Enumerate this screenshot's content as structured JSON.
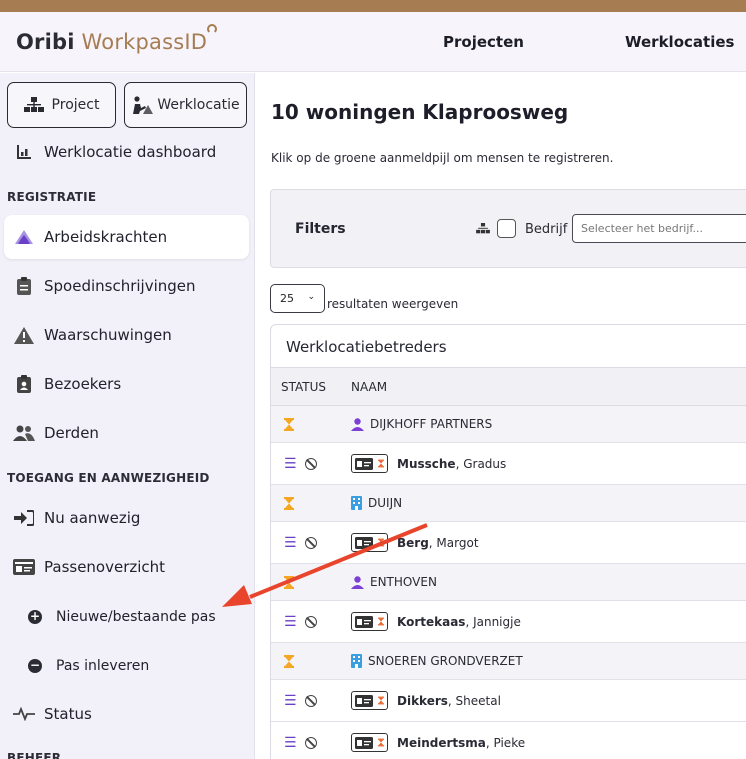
{
  "header": {
    "logo_oribi": "Oribi",
    "logo_workpass": "WorkpassID",
    "nav": [
      "Projecten",
      "Werklocaties"
    ]
  },
  "sidebar": {
    "btn_project": "Project",
    "btn_werklocatie": "Werklocatie",
    "dashboard": "Werklocatie dashboard",
    "heading_registratie": "REGISTRATIE",
    "items_registratie": [
      "Arbeidskrachten",
      "Spoedinschrijvingen",
      "Waarschuwingen",
      "Bezoekers",
      "Derden"
    ],
    "heading_toegang": "TOEGANG EN AANWEZIGHEID",
    "nu_aanwezig": "Nu aanwezig",
    "passenoverzicht": "Passenoverzicht",
    "sub_nieuwe": "Nieuwe/bestaande pas",
    "sub_inleveren": "Pas inleveren",
    "status": "Status",
    "heading_beheer": "BEHEER"
  },
  "main": {
    "title": "10 woningen Klaproosweg",
    "intro": "Klik op de groene aanmeldpijl om mensen te registreren.",
    "filters_label": "Filters",
    "company_label": "Bedrijf",
    "company_placeholder": "Selecteer het bedrijf...",
    "page_size": "25",
    "results_label": "resultaten weergeven",
    "table_title": "Werklocatiebetreders",
    "col_status": "STATUS",
    "col_naam": "NAAM",
    "rows": [
      {
        "type": "group",
        "name": "DIJKHOFF PARTNERS",
        "kind": "person"
      },
      {
        "type": "person",
        "last": "Mussche",
        "first": ", Gradus"
      },
      {
        "type": "group",
        "name": "DUIJN",
        "kind": "building"
      },
      {
        "type": "person",
        "last": "Berg",
        "first": ", Margot"
      },
      {
        "type": "group",
        "name": "ENTHOVEN",
        "kind": "person"
      },
      {
        "type": "person",
        "last": "Kortekaas",
        "first": ", Jannigje"
      },
      {
        "type": "group",
        "name": "SNOEREN GRONDVERZET",
        "kind": "building"
      },
      {
        "type": "person",
        "last": "Dikkers",
        "first": ", Sheetal"
      },
      {
        "type": "person",
        "last": "Meindertsma",
        "first": ", Pieke"
      }
    ]
  },
  "colors": {
    "accent": "#a67c52",
    "purple": "#7b3fd6",
    "blue": "#3a9fe0",
    "amber": "#f5a623",
    "arrow": "#e8452c"
  }
}
